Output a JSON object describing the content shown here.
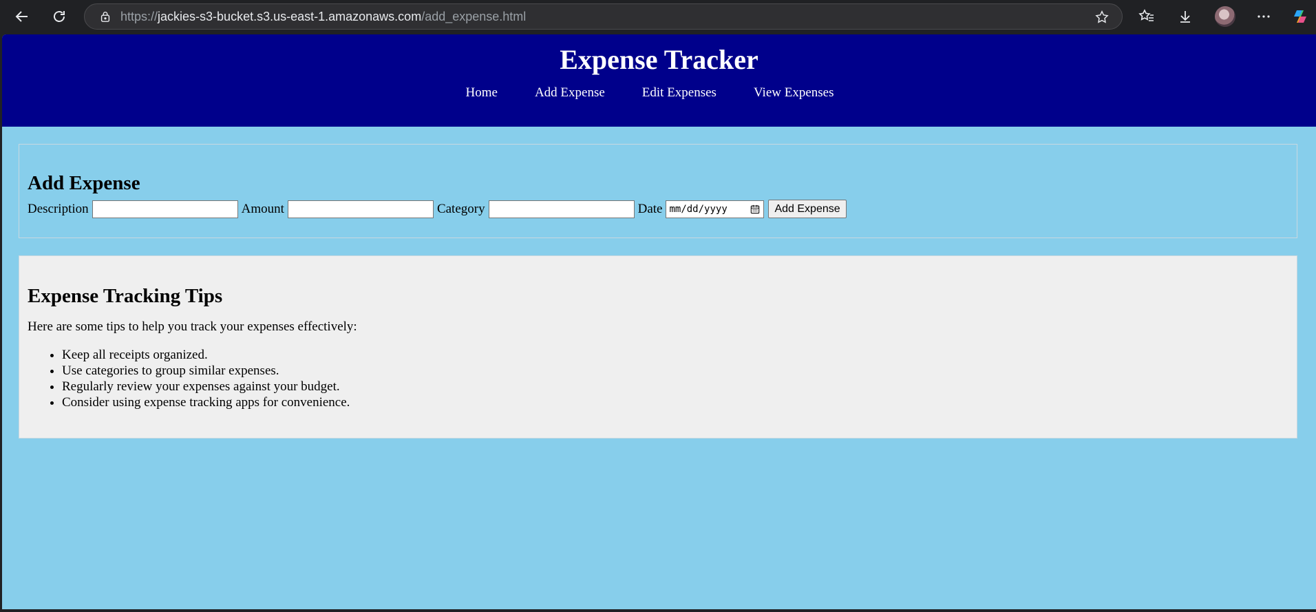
{
  "browser": {
    "url_prefix": "https://",
    "url_host": "jackies-s3-bucket.s3.us-east-1.amazonaws.com",
    "url_path": "/add_expense.html"
  },
  "header": {
    "title": "Expense Tracker",
    "nav": [
      {
        "label": "Home"
      },
      {
        "label": "Add Expense"
      },
      {
        "label": "Edit Expenses"
      },
      {
        "label": "View Expenses"
      }
    ]
  },
  "add_expense": {
    "heading": "Add Expense",
    "description_label": "Description",
    "description_value": "",
    "amount_label": "Amount",
    "amount_value": "",
    "category_label": "Category",
    "category_value": "",
    "date_label": "Date",
    "date_placeholder": "mm/dd/yyyy",
    "submit_label": "Add Expense"
  },
  "tips": {
    "heading": "Expense Tracking Tips",
    "intro": "Here are some tips to help you track your expenses effectively:",
    "items": [
      "Keep all receipts organized.",
      "Use categories to group similar expenses.",
      "Regularly review your expenses against your budget.",
      "Consider using expense tracking apps for convenience."
    ]
  },
  "colors": {
    "header_bg": "#00008b",
    "page_bg": "#87ceeb",
    "tips_bg": "#efefef",
    "browser_bg": "#202124"
  }
}
